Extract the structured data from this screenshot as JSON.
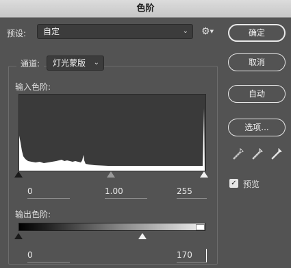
{
  "window": {
    "title": "色阶"
  },
  "preset": {
    "label": "预设:",
    "value": "自定"
  },
  "channel": {
    "label": "通道:",
    "value": "灯光蒙版"
  },
  "input_levels": {
    "label": "输入色阶:",
    "black": "0",
    "gamma": "1.00",
    "white": "255"
  },
  "output_levels": {
    "label": "输出色阶:",
    "black": "0",
    "white": "170"
  },
  "buttons": {
    "ok": "确定",
    "cancel": "取消",
    "auto": "自动",
    "options": "选项..."
  },
  "preview": {
    "label": "预览",
    "checked": true
  },
  "icons": [
    "gear-icon",
    "chevron-down-icon",
    "black-eyedropper-icon",
    "gray-eyedropper-icon",
    "white-eyedropper-icon"
  ]
}
